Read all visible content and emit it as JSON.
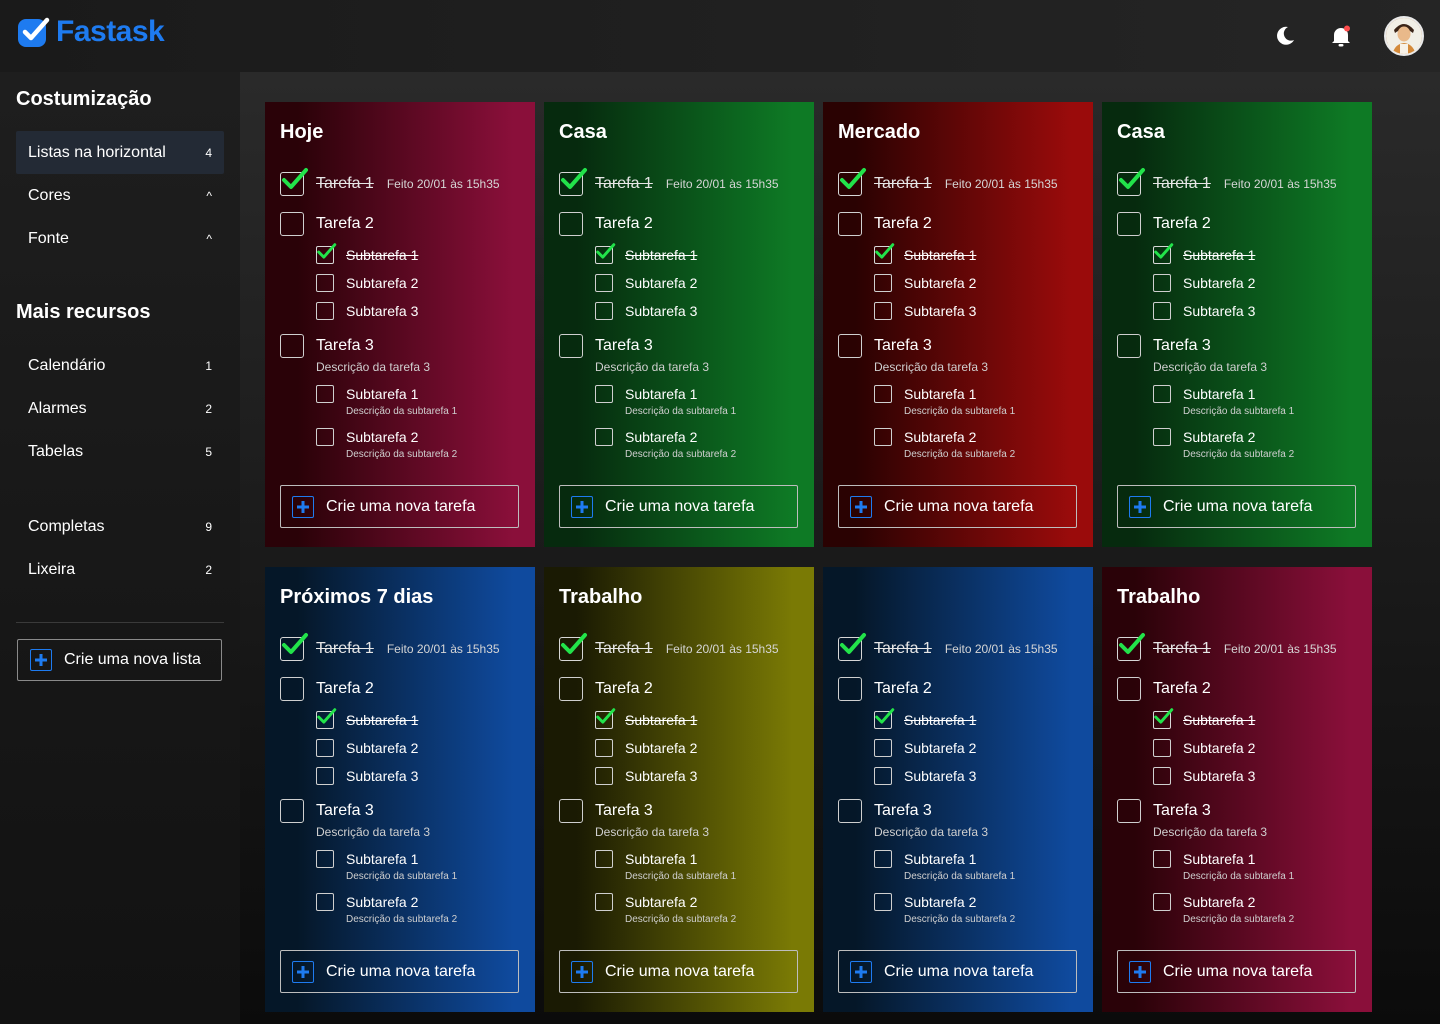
{
  "app": {
    "name": "Fastask"
  },
  "header": {
    "icons": [
      "moon-icon",
      "bell-icon",
      "avatar"
    ],
    "colors": {
      "brand": "#1e7bf0",
      "notification": "#ff4d4d"
    }
  },
  "sidebar": {
    "customization_title": "Costumização",
    "customization_items": [
      {
        "label": "Listas na horizontal",
        "badge": "4"
      },
      {
        "label": "Cores",
        "badge": "^"
      },
      {
        "label": "Fonte",
        "badge": "^"
      }
    ],
    "resources_title": "Mais recursos",
    "resource_items": [
      {
        "label": "Calendário",
        "badge": "1"
      },
      {
        "label": "Alarmes",
        "badge": "2"
      },
      {
        "label": "Tabelas",
        "badge": "5"
      }
    ],
    "extra_items": [
      {
        "label": "Completas",
        "badge": "9"
      },
      {
        "label": "Lixeira",
        "badge": "2"
      }
    ],
    "new_list_label": "Crie uma nova lista"
  },
  "task_template": {
    "task1": "Tarefa 1",
    "task1_meta": "Feito 20/01 às 15h35",
    "task2": "Tarefa 2",
    "task2_subtasks": [
      "Subtarefa 1",
      "Subtarefa 2",
      "Subtarefa 3"
    ],
    "task3": "Tarefa 3",
    "task3_desc": "Descrição da tarefa 3",
    "task3_subtasks": [
      {
        "label": "Subtarefa 1",
        "desc": "Descrição da subtarefa 1"
      },
      {
        "label": "Subtarefa 2",
        "desc": "Descrição da subtarefa 2"
      }
    ],
    "new_task_label": "Crie uma nova tarefa"
  },
  "lists": [
    {
      "title": "Hoje",
      "accent": "#8a0f3a",
      "dark": "#2a0208"
    },
    {
      "title": "Casa",
      "accent": "#0e7a25",
      "dark": "#062a0e"
    },
    {
      "title": "Mercado",
      "accent": "#9a0b0b",
      "dark": "#2a0202"
    },
    {
      "title": "Casa",
      "accent": "#0e7a25",
      "dark": "#062a0e"
    },
    {
      "title": "Próximos 7 dias",
      "accent": "#0f4a9e",
      "dark": "#051728"
    },
    {
      "title": "Trabalho",
      "accent": "#7a7a05",
      "dark": "#1a1a03"
    },
    {
      "title": "",
      "accent": "#0f4a9e",
      "dark": "#051728"
    },
    {
      "title": "Trabalho",
      "accent": "#8a0f3a",
      "dark": "#2a0208"
    }
  ]
}
